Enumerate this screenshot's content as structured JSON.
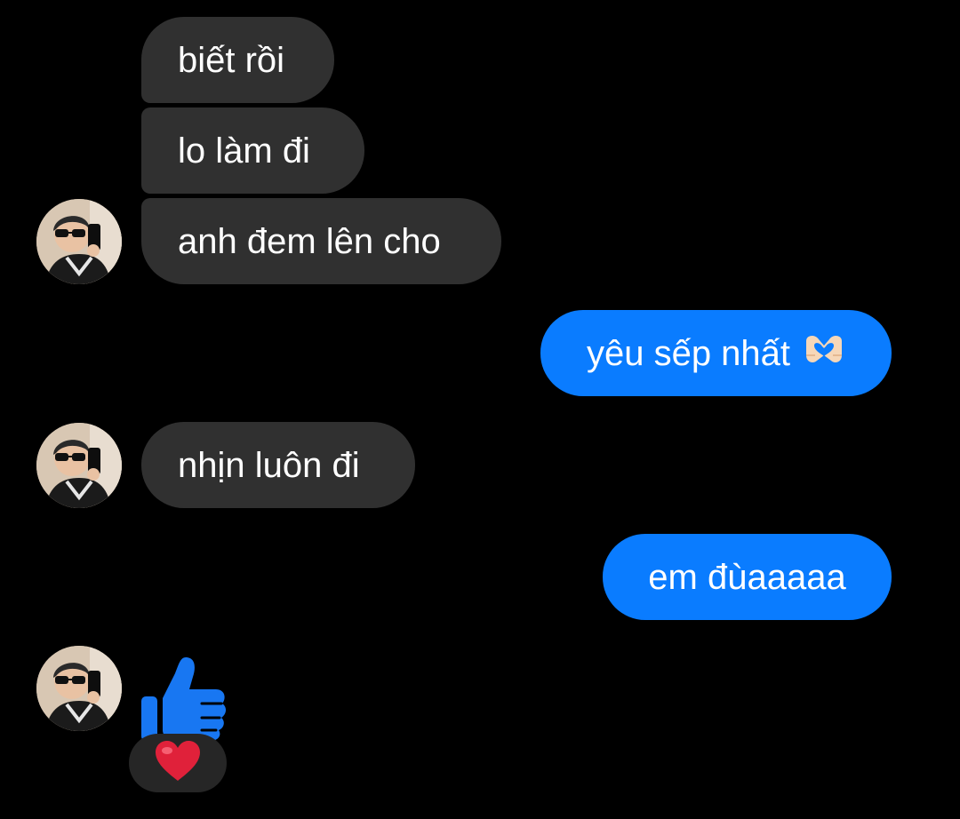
{
  "messages": [
    {
      "side": "incoming",
      "text": "biết rồi"
    },
    {
      "side": "incoming",
      "text": "lo làm đi"
    },
    {
      "side": "incoming",
      "text": "anh đem lên cho"
    },
    {
      "side": "outgoing",
      "text": "yêu sếp nhất",
      "emoji": "heart-hands"
    },
    {
      "side": "incoming",
      "text": "nhịn luôn đi"
    },
    {
      "side": "outgoing",
      "text": "em đùaaaaa"
    },
    {
      "side": "incoming",
      "sticker": "thumbs-up-like",
      "reaction": "red-heart"
    }
  ],
  "colors": {
    "background": "#000000",
    "incoming_bubble": "#303030",
    "outgoing_bubble": "#0a7cff",
    "like_blue": "#1877f2",
    "reaction_heart": "#e0213a"
  },
  "icons": {
    "avatar": "contact-avatar-photo",
    "inline_emoji": "heart-hands-emoji",
    "sticker": "thumbs-up-like-icon",
    "reaction": "red-heart-icon"
  }
}
